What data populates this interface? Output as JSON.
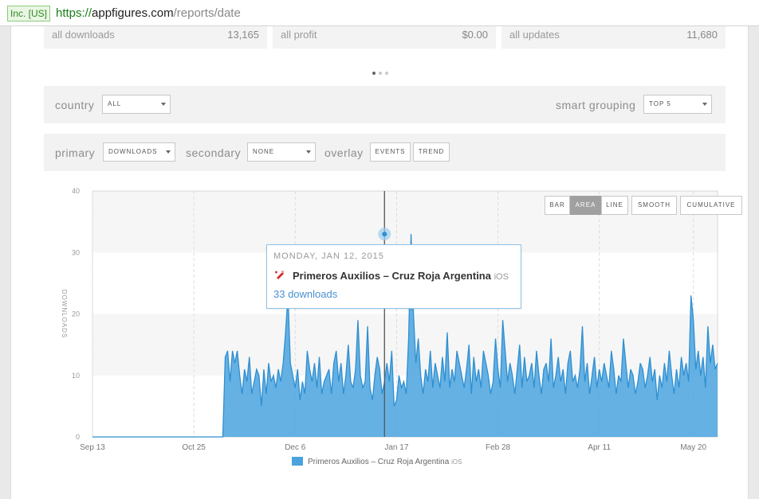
{
  "browser": {
    "secure_label": "Inc. [US]",
    "url_scheme": "https://",
    "url_host": "appfigures.com",
    "url_path": "/reports/date"
  },
  "stats": [
    {
      "label": "all downloads",
      "value": "13,165"
    },
    {
      "label": "all profit",
      "value": "$0.00"
    },
    {
      "label": "all updates",
      "value": "11,680"
    }
  ],
  "filters": {
    "country_label": "country",
    "country_value": "ALL",
    "smart_grouping_label": "smart grouping",
    "smart_grouping_value": "TOP 5",
    "primary_label": "primary",
    "primary_value": "DOWNLOADS",
    "secondary_label": "secondary",
    "secondary_value": "NONE",
    "overlay_label": "overlay",
    "events_label": "EVENTS",
    "trend_label": "TREND"
  },
  "chart_modes": [
    {
      "label": "BAR",
      "active": false
    },
    {
      "label": "AREA",
      "active": true
    },
    {
      "label": "LINE",
      "active": false
    },
    {
      "label": "SMOOTH",
      "active": false
    },
    {
      "label": "CUMULATIVE",
      "active": false
    }
  ],
  "tooltip": {
    "date": "MONDAY, JAN 12, 2015",
    "app_name": "Primeros Auxilios – Cruz Roja Argentina",
    "platform": "iOS",
    "value_text": "33 downloads"
  },
  "chart_data": {
    "type": "area",
    "ylabel": "DOWNLOADS",
    "ylim": [
      0,
      40
    ],
    "y_ticks": [
      0,
      10,
      20,
      30,
      40
    ],
    "x_tick_labels": [
      "Sep 13",
      "Oct 25",
      "Dec 6",
      "Jan 17",
      "Feb 28",
      "Apr 11",
      "May 20"
    ],
    "x_tick_days": [
      0,
      42,
      84,
      126,
      168,
      210,
      249
    ],
    "color": "#4aa3df",
    "series": [
      {
        "name": "Primeros Auxilios – Cruz Roja Argentina",
        "platform": "iOS",
        "start_date": "2014-09-13",
        "values": [
          0,
          0,
          0,
          0,
          0,
          0,
          0,
          0,
          0,
          0,
          0,
          0,
          0,
          0,
          0,
          0,
          0,
          0,
          0,
          0,
          0,
          0,
          0,
          0,
          0,
          0,
          0,
          0,
          0,
          0,
          0,
          0,
          0,
          0,
          0,
          0,
          0,
          0,
          0,
          0,
          0,
          0,
          0,
          0,
          0,
          0,
          0,
          0,
          0,
          0,
          0,
          0,
          0,
          0,
          0,
          13,
          14,
          9,
          14,
          12,
          14,
          10,
          7,
          11,
          9,
          13,
          7,
          9,
          11,
          10,
          5,
          11,
          7,
          12,
          9,
          10,
          8,
          11,
          9,
          12,
          17,
          23,
          12,
          10,
          8,
          11,
          6,
          9,
          7,
          14,
          11,
          9,
          12,
          8,
          13,
          7,
          9,
          10,
          11,
          7,
          12,
          14,
          9,
          12,
          7,
          10,
          15,
          9,
          8,
          11,
          19,
          10,
          8,
          9,
          18,
          8,
          6,
          10,
          13,
          11,
          7,
          9,
          12,
          9,
          14,
          5,
          6,
          10,
          8,
          9,
          7,
          16,
          33,
          20,
          12,
          16,
          10,
          7,
          11,
          9,
          14,
          8,
          12,
          10,
          8,
          13,
          9,
          17,
          8,
          11,
          9,
          14,
          12,
          10,
          8,
          11,
          15,
          7,
          13,
          9,
          11,
          8,
          14,
          12,
          10,
          7,
          9,
          16,
          11,
          8,
          19,
          14,
          9,
          12,
          10,
          7,
          11,
          15,
          8,
          13,
          9,
          10,
          12,
          8,
          14,
          10,
          7,
          11,
          12,
          9,
          16,
          8,
          10,
          13,
          9,
          11,
          7,
          12,
          14,
          9,
          10,
          8,
          11,
          18,
          9,
          12,
          7,
          10,
          13,
          8,
          11,
          9,
          12,
          10,
          8,
          14,
          11,
          7,
          10,
          9,
          16,
          12,
          8,
          11,
          10,
          7,
          9,
          12,
          11,
          8,
          10,
          13,
          9,
          11,
          6,
          10,
          8,
          12,
          9,
          14,
          10,
          7,
          11,
          8,
          13,
          10,
          12,
          9,
          23,
          19,
          11,
          14,
          10,
          13,
          8,
          18,
          12,
          15,
          11,
          12
        ]
      }
    ],
    "highlight": {
      "label": "MONDAY, JAN 12, 2015",
      "day": 121,
      "value": 33
    }
  },
  "legend": {
    "name": "Primeros Auxilios – Cruz Roja Argentina",
    "platform": "iOS"
  }
}
